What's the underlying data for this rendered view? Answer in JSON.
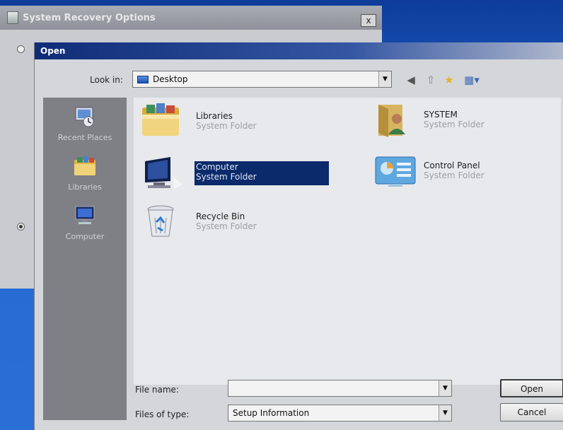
{
  "background_window": {
    "title": "System Recovery Options",
    "close_glyph": "x"
  },
  "dialog": {
    "title": "Open",
    "look_in_label": "Look in:",
    "look_in_value": "Desktop"
  },
  "toolbar": {
    "back_glyph": "◀",
    "up_glyph": "⇧",
    "new_folder_glyph": "★",
    "views_glyph": "▦"
  },
  "places": [
    {
      "label": "Recent Places",
      "icon": "recent-places-icon"
    },
    {
      "label": "Libraries",
      "icon": "libraries-icon"
    },
    {
      "label": "Computer",
      "icon": "computer-icon"
    }
  ],
  "files": [
    {
      "name": "Libraries",
      "type": "System Folder",
      "icon": "libraries-folder-icon",
      "selected": false
    },
    {
      "name": "SYSTEM",
      "type": "System Folder",
      "icon": "user-folder-icon",
      "selected": false
    },
    {
      "name": "Computer",
      "type": "System Folder",
      "icon": "computer-icon",
      "selected": true
    },
    {
      "name": "Control Panel",
      "type": "System Folder",
      "icon": "control-panel-icon",
      "selected": false
    },
    {
      "name": "Recycle Bin",
      "type": "System Folder",
      "icon": "recycle-bin-icon",
      "selected": false
    }
  ],
  "bottom": {
    "file_name_label": "File name:",
    "file_name_value": "",
    "files_of_type_label": "Files of type:",
    "files_of_type_value": "Setup Information",
    "open_button": "Open",
    "cancel_button": "Cancel"
  },
  "colors": {
    "selection": "#0b2a6b",
    "title_bar": "#0f2c77",
    "desktop": "#2a6fd6"
  }
}
